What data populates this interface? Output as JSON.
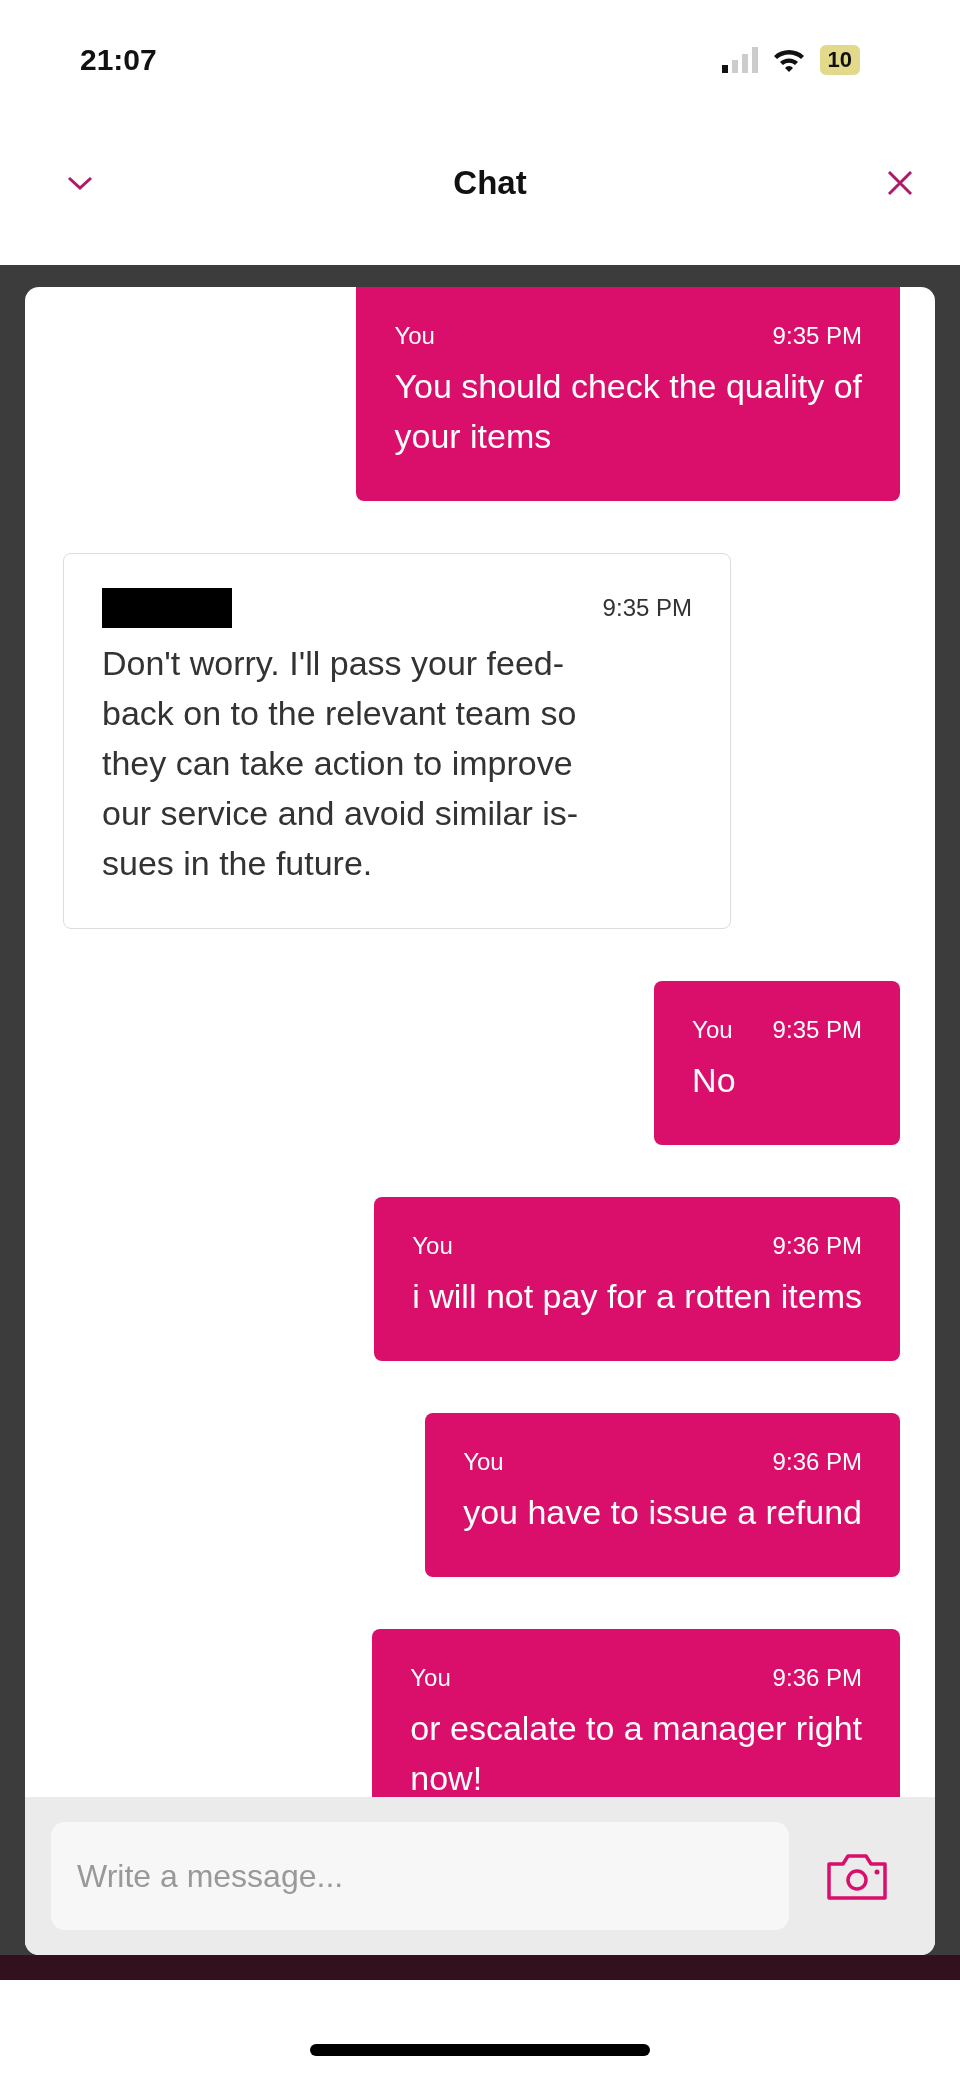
{
  "status_bar": {
    "time": "21:07",
    "battery": "10"
  },
  "header": {
    "title": "Chat"
  },
  "messages": [
    {
      "kind": "outgoing",
      "sender": "You",
      "time": "9:35 PM",
      "lines": [
        "You should check the quality of",
        "your items"
      ]
    },
    {
      "kind": "incoming",
      "redacted": true,
      "time": "9:35 PM",
      "lines": [
        "Don't worry. I'll pass your feed-",
        "back on to the relevant team so",
        "they can take action to improve",
        "our service and avoid similar is-",
        "sues in the future."
      ]
    },
    {
      "kind": "outgoing",
      "sender": "You",
      "time": "9:35 PM",
      "lines": [
        "No"
      ]
    },
    {
      "kind": "outgoing",
      "sender": "You",
      "time": "9:36 PM",
      "lines": [
        "i will not pay for a rotten items"
      ]
    },
    {
      "kind": "outgoing",
      "sender": "You",
      "time": "9:36 PM",
      "lines": [
        "you have to issue a refund"
      ]
    },
    {
      "kind": "outgoing",
      "sender": "You",
      "time": "9:36 PM",
      "lines": [
        "or escalate to a manager right",
        "now!"
      ]
    }
  ],
  "composer": {
    "placeholder": "Write a message..."
  }
}
